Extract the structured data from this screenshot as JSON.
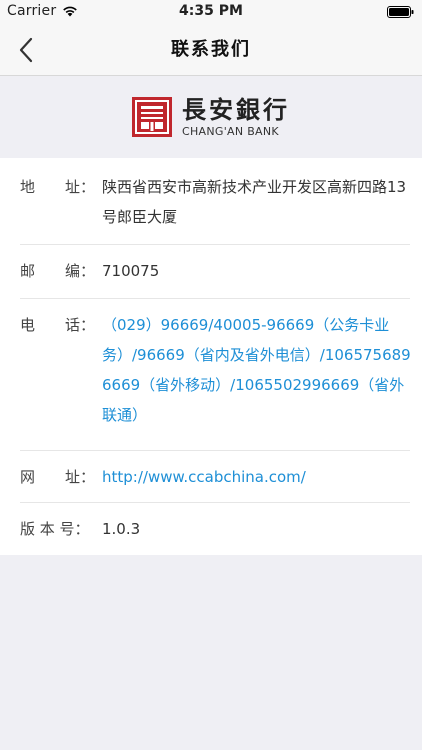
{
  "status_bar": {
    "carrier": "Carrier",
    "time": "4:35 PM"
  },
  "nav": {
    "title": "联系我们"
  },
  "logo": {
    "chinese_name": "長安銀行",
    "english_name": "CHANG'AN BANK",
    "brand_color": "#c0272d"
  },
  "contact": {
    "address": {
      "label": "地　　址：",
      "value": "陕西省西安市高新技术产业开发区高新四路13号郎臣大厦"
    },
    "postcode": {
      "label": "邮　　编：",
      "value": "710075"
    },
    "phone": {
      "label": "电　　话：",
      "value": "（029）96669/40005-96669（公务卡业务）/96669（省内及省外电信）/1065756896669（省外移动）/1065502996669（省外联通）"
    },
    "website": {
      "label": "网　　址：",
      "value": "http://www.ccabchina.com/"
    },
    "version": {
      "label": "版 本 号：",
      "value": "1.0.3"
    }
  },
  "colors": {
    "link": "#1e8fd6",
    "background": "#efeff4"
  }
}
